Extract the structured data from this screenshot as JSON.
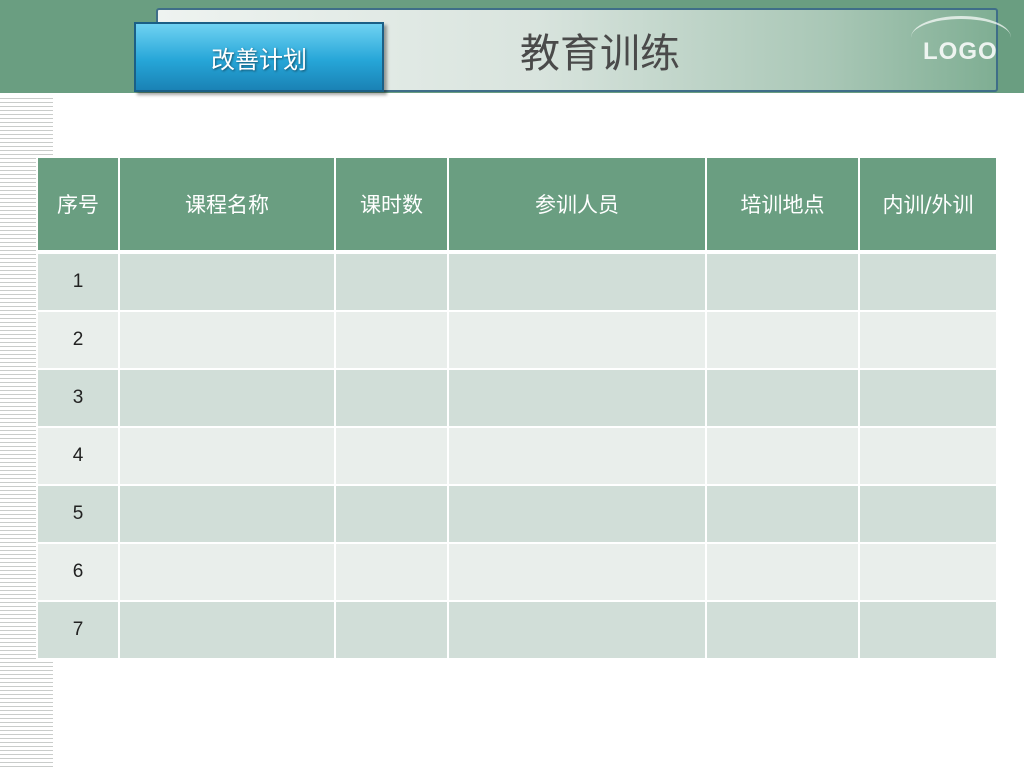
{
  "header": {
    "section_tab": "改善计划",
    "title": "教育训练",
    "logo_text": "LOGO"
  },
  "colors": {
    "header_band": "#6a9e81",
    "table_header": "#6a9e81",
    "row_odd": "#d1ded8",
    "row_even": "#e9eeeb",
    "tab_blue": "#26a6d8"
  },
  "table": {
    "columns": [
      "序号",
      "课程名称",
      "课时数",
      "参训人员",
      "培训地点",
      "内训/外训"
    ],
    "rows": [
      [
        "1",
        "",
        "",
        "",
        "",
        ""
      ],
      [
        "2",
        "",
        "",
        "",
        "",
        ""
      ],
      [
        "3",
        "",
        "",
        "",
        "",
        ""
      ],
      [
        "4",
        "",
        "",
        "",
        "",
        ""
      ],
      [
        "5",
        "",
        "",
        "",
        "",
        ""
      ],
      [
        "6",
        "",
        "",
        "",
        "",
        ""
      ],
      [
        "7",
        "",
        "",
        "",
        "",
        ""
      ]
    ]
  }
}
